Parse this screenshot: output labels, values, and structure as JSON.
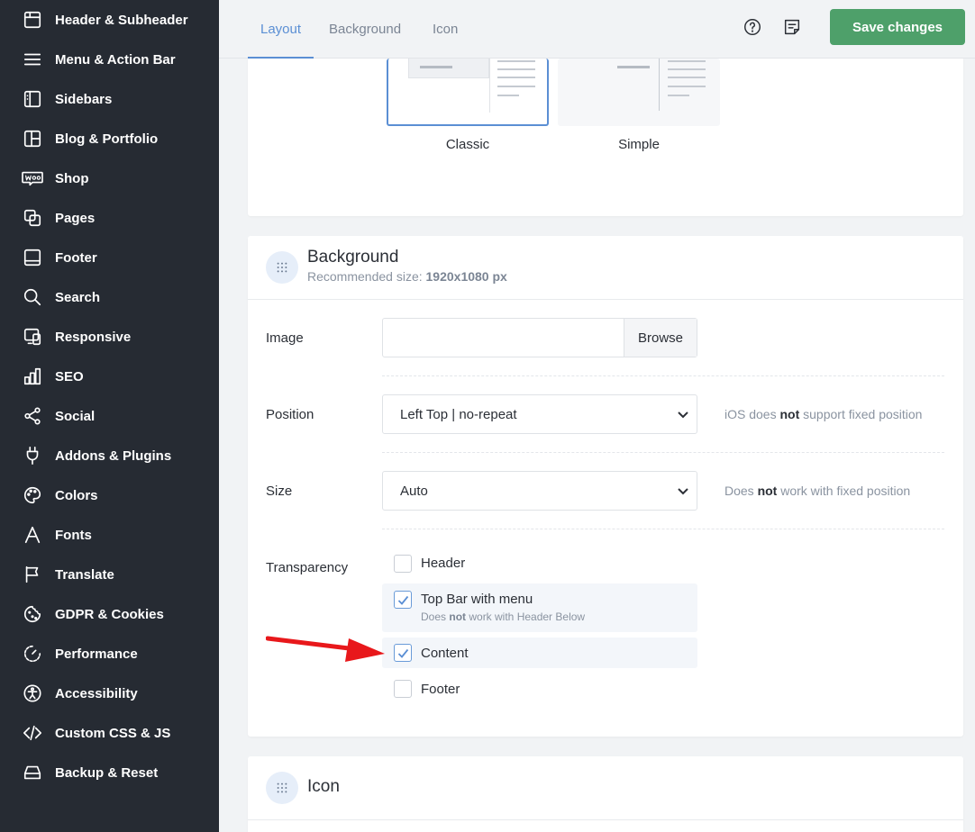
{
  "sidebar": {
    "items": [
      {
        "label": "Header & Subheader",
        "icon": "header-icon"
      },
      {
        "label": "Menu & Action Bar",
        "icon": "menu-icon"
      },
      {
        "label": "Sidebars",
        "icon": "sidebars-icon"
      },
      {
        "label": "Blog & Portfolio",
        "icon": "blog-icon"
      },
      {
        "label": "Shop",
        "icon": "woo-icon"
      },
      {
        "label": "Pages",
        "icon": "pages-icon"
      },
      {
        "label": "Footer",
        "icon": "footer-icon"
      },
      {
        "label": "Search",
        "icon": "search-icon"
      },
      {
        "label": "Responsive",
        "icon": "responsive-icon"
      },
      {
        "label": "SEO",
        "icon": "seo-icon"
      },
      {
        "label": "Social",
        "icon": "share-icon"
      },
      {
        "label": "Addons & Plugins",
        "icon": "plug-icon"
      },
      {
        "label": "Colors",
        "icon": "palette-icon"
      },
      {
        "label": "Fonts",
        "icon": "font-icon"
      },
      {
        "label": "Translate",
        "icon": "flag-icon"
      },
      {
        "label": "GDPR & Cookies",
        "icon": "cookie-icon"
      },
      {
        "label": "Performance",
        "icon": "performance-icon"
      },
      {
        "label": "Accessibility",
        "icon": "accessibility-icon"
      },
      {
        "label": "Custom CSS & JS",
        "icon": "code-icon"
      },
      {
        "label": "Backup & Reset",
        "icon": "backup-icon"
      }
    ]
  },
  "topbar": {
    "tabs": [
      {
        "label": "Layout",
        "active": true
      },
      {
        "label": "Background",
        "active": false
      },
      {
        "label": "Icon",
        "active": false
      }
    ],
    "save_label": "Save changes"
  },
  "layout_card": {
    "options": [
      {
        "label": "Classic",
        "selected": true
      },
      {
        "label": "Simple",
        "selected": false
      }
    ]
  },
  "background_card": {
    "title": "Background",
    "subtitle_prefix": "Recommended size: ",
    "subtitle_value": "1920x1080 px",
    "image": {
      "label": "Image",
      "value": "",
      "browse_label": "Browse"
    },
    "position": {
      "label": "Position",
      "value": "Left Top | no-repeat",
      "hint_prefix": "iOS does ",
      "hint_bold": "not",
      "hint_suffix": " support fixed position"
    },
    "size": {
      "label": "Size",
      "value": "Auto",
      "hint_prefix": "Does ",
      "hint_bold": "not",
      "hint_suffix": " work with fixed position"
    },
    "transparency": {
      "label": "Transparency",
      "options": [
        {
          "label": "Header",
          "checked": false
        },
        {
          "label": "Top Bar with menu",
          "checked": true,
          "sub_prefix": "Does ",
          "sub_bold": "not",
          "sub_suffix": " work with Header Below"
        },
        {
          "label": "Content",
          "checked": true
        },
        {
          "label": "Footer",
          "checked": false
        }
      ]
    }
  },
  "icon_card": {
    "title": "Icon"
  },
  "colors": {
    "sidebar_bg": "#262b33",
    "accent": "#5b8fd4",
    "save_green": "#4ea06a",
    "annotation_arrow": "#e8181b"
  }
}
